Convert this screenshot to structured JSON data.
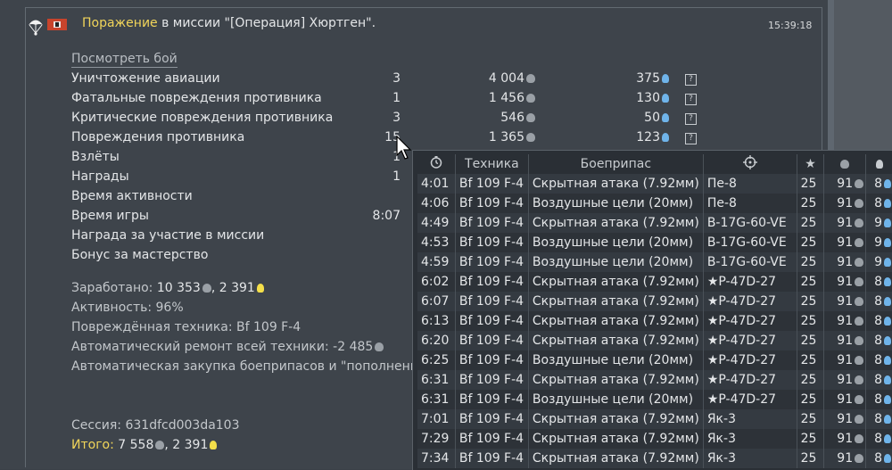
{
  "header": {
    "result": "Поражение",
    "message": " в миссии \"[Операция] Хюртген\".",
    "time": "15:39:18"
  },
  "view_battle": "Посмотреть бой",
  "stats": [
    {
      "label": "Уничтожение авиации",
      "count": "3",
      "sl": "4 004",
      "rp": "375",
      "help": "?"
    },
    {
      "label": "Фатальные повреждения противника",
      "count": "1",
      "sl": "1 456",
      "rp": "130",
      "help": "?"
    },
    {
      "label": "Критические повреждения противника",
      "count": "3",
      "sl": "546",
      "rp": "50",
      "help": "?"
    },
    {
      "label": "Повреждения противника",
      "count": "15",
      "sl": "1 365",
      "rp": "123",
      "help": "?"
    },
    {
      "label": "Взлёты",
      "count": "1",
      "sl": "",
      "rp": "",
      "help": ""
    },
    {
      "label": "Награды",
      "count": "1",
      "sl": "",
      "rp": "",
      "help": ""
    },
    {
      "label": "Время активности",
      "count": "",
      "sl": "",
      "rp": "",
      "help": ""
    },
    {
      "label": "Время игры",
      "count": "8:07",
      "sl": "",
      "rp": "",
      "help": ""
    },
    {
      "label": "Награда за участие в миссии",
      "count": "",
      "sl": "",
      "rp": "",
      "help": ""
    },
    {
      "label": "Бонус за мастерство",
      "count": "",
      "sl": "",
      "rp": "",
      "help": ""
    }
  ],
  "summary": {
    "earned_label": "Заработано: ",
    "earned_sl": "10 353",
    "earned_sep": ", ",
    "earned_rp": "2 391",
    "activity": "Активность: 96%",
    "damaged": "Повреждённая техника: Bf 109 F-4",
    "repair_label": "Автоматический ремонт всей техники: ",
    "repair_value": "-2 485",
    "ammo": "Автоматическая закупка боеприпасов и \"пополнения экипажа\"",
    "session": "Сессия: 631dfcd003da103",
    "total_label": "Итого:",
    "total_sl": " 7 558",
    "total_sep": ", ",
    "total_rp": "2 391"
  },
  "tooltip": {
    "columns": [
      "clock-icon",
      "Техника",
      "Боеприпас",
      "target-icon",
      "star-icon",
      "silver-lion-icon",
      "research-icon"
    ],
    "headers": {
      "vehicle": "Техника",
      "ammo": "Боеприпас"
    },
    "rows": [
      {
        "time": "4:01",
        "vehicle": "Bf 109 F-4",
        "ammo": "Скрытная атака (7.92мм)",
        "target": "Пе-8",
        "star": "25",
        "sl": "91",
        "rp": "8"
      },
      {
        "time": "4:06",
        "vehicle": "Bf 109 F-4",
        "ammo": "Воздушные цели (20мм)",
        "target": "Пе-8",
        "star": "25",
        "sl": "91",
        "rp": "8"
      },
      {
        "time": "4:49",
        "vehicle": "Bf 109 F-4",
        "ammo": "Скрытная атака (7.92мм)",
        "target": "B-17G-60-VE",
        "star": "25",
        "sl": "91",
        "rp": "9"
      },
      {
        "time": "4:53",
        "vehicle": "Bf 109 F-4",
        "ammo": "Воздушные цели (20мм)",
        "target": "B-17G-60-VE",
        "star": "25",
        "sl": "91",
        "rp": "9"
      },
      {
        "time": "4:59",
        "vehicle": "Bf 109 F-4",
        "ammo": "Воздушные цели (20мм)",
        "target": "B-17G-60-VE",
        "star": "25",
        "sl": "91",
        "rp": "9"
      },
      {
        "time": "6:02",
        "vehicle": "Bf 109 F-4",
        "ammo": "Скрытная атака (7.92мм)",
        "target": "★P-47D-27",
        "star": "25",
        "sl": "91",
        "rp": "8"
      },
      {
        "time": "6:07",
        "vehicle": "Bf 109 F-4",
        "ammo": "Скрытная атака (7.92мм)",
        "target": "★P-47D-27",
        "star": "25",
        "sl": "91",
        "rp": "8"
      },
      {
        "time": "6:13",
        "vehicle": "Bf 109 F-4",
        "ammo": "Скрытная атака (7.92мм)",
        "target": "★P-47D-27",
        "star": "25",
        "sl": "91",
        "rp": "8"
      },
      {
        "time": "6:20",
        "vehicle": "Bf 109 F-4",
        "ammo": "Скрытная атака (7.92мм)",
        "target": "★P-47D-27",
        "star": "25",
        "sl": "91",
        "rp": "8"
      },
      {
        "time": "6:25",
        "vehicle": "Bf 109 F-4",
        "ammo": "Воздушные цели (20мм)",
        "target": "★P-47D-27",
        "star": "25",
        "sl": "91",
        "rp": "8"
      },
      {
        "time": "6:31",
        "vehicle": "Bf 109 F-4",
        "ammo": "Скрытная атака (7.92мм)",
        "target": "★P-47D-27",
        "star": "25",
        "sl": "91",
        "rp": "8"
      },
      {
        "time": "6:31",
        "vehicle": "Bf 109 F-4",
        "ammo": "Воздушные цели (20мм)",
        "target": "★P-47D-27",
        "star": "25",
        "sl": "91",
        "rp": "8"
      },
      {
        "time": "7:01",
        "vehicle": "Bf 109 F-4",
        "ammo": "Скрытная атака (7.92мм)",
        "target": "Як-3",
        "star": "25",
        "sl": "91",
        "rp": "8"
      },
      {
        "time": "7:29",
        "vehicle": "Bf 109 F-4",
        "ammo": "Скрытная атака (7.92мм)",
        "target": "Як-3",
        "star": "25",
        "sl": "91",
        "rp": "8"
      },
      {
        "time": "7:34",
        "vehicle": "Bf 109 F-4",
        "ammo": "Скрытная атака (7.92мм)",
        "target": "Як-3",
        "star": "25",
        "sl": "91",
        "rp": "8"
      }
    ]
  },
  "colors": {
    "accent": "#f1d55a",
    "research": "#6fb4ea",
    "premium": "#f4df4a"
  }
}
